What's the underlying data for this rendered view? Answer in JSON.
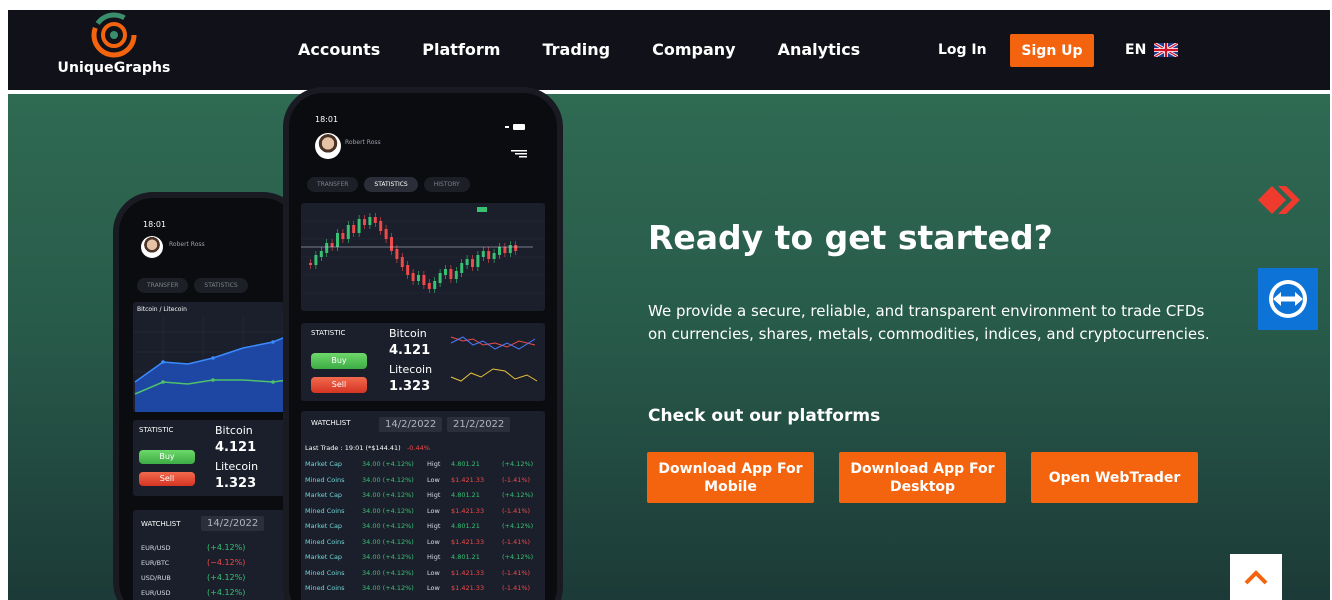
{
  "brand": {
    "name": "UniqueGraphs"
  },
  "nav": {
    "items": [
      "Accounts",
      "Platform",
      "Trading",
      "Company",
      "Analytics"
    ],
    "login": "Log In",
    "signup": "Sign Up",
    "language": "EN"
  },
  "hero": {
    "title": "Ready to get started?",
    "description": "We provide a secure, reliable, and transparent environment to trade CFDs on currencies, shares, metals, commodities, indices, and cryptocurrencies.",
    "subtitle": "Check out our platforms",
    "buttons": {
      "mobile": "Download App For Mobile",
      "desktop": "Download App For Desktop",
      "web": "Open WebTrader"
    }
  },
  "phone_front": {
    "time": "18:01",
    "user": "Robert Ross",
    "tabs": [
      "TRANSFER",
      "STATISTICS",
      "HISTORY"
    ],
    "statistic_label": "STATISTIC",
    "buy": "Buy",
    "sell": "Sell",
    "coin1": "Bitcoin",
    "coin1_value": "4.121",
    "coin2": "Litecoin",
    "coin2_value": "1.323",
    "watchlist": "WATCHLIST",
    "date1": "14/2/2022",
    "date2": "21/2/2022",
    "last_trade": "Last Trade : 19:01 (*$144.41)",
    "last_trade_change": "-0.44%",
    "rows": [
      {
        "name": "Market Cap",
        "val": "34.00 (+4.12%)",
        "k": "Higt",
        "v": "4.801.21",
        "p": "(+4.12%)",
        "type": "up"
      },
      {
        "name": "Mined Coins",
        "val": "34.00 (+4.12%)",
        "k": "Low",
        "v": "$1.421.33",
        "p": "(-1.41%)",
        "type": "down"
      },
      {
        "name": "Market Cap",
        "val": "34.00 (+4.12%)",
        "k": "Higt",
        "v": "4.801.21",
        "p": "(+4.12%)",
        "type": "up"
      },
      {
        "name": "Mined Coins",
        "val": "34.00 (+4.12%)",
        "k": "Low",
        "v": "$1.421.33",
        "p": "(-1.41%)",
        "type": "down"
      },
      {
        "name": "Market Cap",
        "val": "34.00 (+4.12%)",
        "k": "Higt",
        "v": "4.801.21",
        "p": "(+4.12%)",
        "type": "up"
      },
      {
        "name": "Mined Coins",
        "val": "34.00 (+4.12%)",
        "k": "Low",
        "v": "$1.421.33",
        "p": "(-1.41%)",
        "type": "down"
      },
      {
        "name": "Market Cap",
        "val": "34.00 (+4.12%)",
        "k": "Higt",
        "v": "4.801.21",
        "p": "(+4.12%)",
        "type": "up"
      },
      {
        "name": "Mined Coins",
        "val": "34.00 (+4.12%)",
        "k": "Low",
        "v": "$1.421.33",
        "p": "(-1.41%)",
        "type": "down"
      },
      {
        "name": "Mined Coins",
        "val": "34.00 (+4.12%)",
        "k": "Low",
        "v": "$1.421.33",
        "p": "(-1.41%)",
        "type": "down"
      }
    ]
  },
  "phone_back": {
    "time": "18:01",
    "user": "Robert Ross",
    "tabs": [
      "TRANSFER",
      "STATISTICS"
    ],
    "chart_title": "Bitcoin / Litecoin",
    "statistic_label": "STATISTIC",
    "buy": "Buy",
    "sell": "Sell",
    "coin1": "Bitcoin",
    "coin1_value": "4.121",
    "coin2": "Litecoin",
    "coin2_value": "1.323",
    "watchlist": "WATCHLIST",
    "date1": "14/2/2022",
    "rows": [
      {
        "pair": "EUR/USD",
        "pct": "(+4.12%)",
        "type": "up"
      },
      {
        "pair": "EUR/BTC",
        "pct": "(−4.12%)",
        "type": "down"
      },
      {
        "pair": "USD/RUB",
        "pct": "(+4.12%)",
        "type": "up"
      },
      {
        "pair": "EUR/USD",
        "pct": "(+4.12%)",
        "type": "up"
      }
    ]
  },
  "colors": {
    "accent": "#f4640e",
    "nav_bg": "#111219",
    "hero_top": "#2f6a53",
    "hero_bottom": "#1c3a37"
  }
}
